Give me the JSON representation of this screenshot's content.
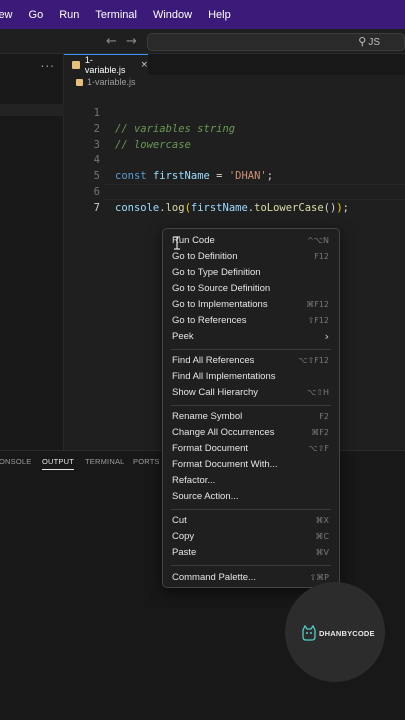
{
  "menubar": {
    "items": [
      "iew",
      "Go",
      "Run",
      "Terminal",
      "Window",
      "Help"
    ]
  },
  "titlebar": {
    "back_icon": "arrow-left-icon",
    "forward_icon": "arrow-right-icon",
    "search_label": "JS"
  },
  "sidebar": {
    "more_label": "..."
  },
  "tab": {
    "label": "1-variable.js",
    "close": "×"
  },
  "breadcrumb": {
    "file": "1-variable.js"
  },
  "editor": {
    "lines": [
      {
        "n": "1",
        "text": "// variables string"
      },
      {
        "n": "2",
        "text": "// lowercase"
      },
      {
        "n": "3",
        "text": ""
      },
      {
        "n": "4",
        "text": "const firstName = 'DHAN';"
      },
      {
        "n": "5",
        "text": ""
      },
      {
        "n": "6",
        "text": "console.log(firstName.toLowerCase());"
      },
      {
        "n": "7",
        "text": ""
      }
    ],
    "tokens": {
      "kw_const": "const",
      "var_firstName": "firstName",
      "op_eq": "=",
      "str_dhan": "'DHAN'",
      "semi": ";",
      "var_console": "console",
      "dot": ".",
      "fn_log": "log",
      "paren_open": "(",
      "fn_lower": "toLowerCase",
      "call_parens": "()",
      "paren_close": ")"
    }
  },
  "panel": {
    "tabs": [
      "ONSOLE",
      "OUTPUT",
      "TERMINAL",
      "PORTS"
    ],
    "active": "OUTPUT"
  },
  "context_menu": {
    "groups": [
      [
        {
          "label": "Run Code",
          "key": "^⌥N"
        },
        {
          "label": "Go to Definition",
          "key": "F12"
        },
        {
          "label": "Go to Type Definition",
          "key": ""
        },
        {
          "label": "Go to Source Definition",
          "key": ""
        },
        {
          "label": "Go to Implementations",
          "key": "⌘F12"
        },
        {
          "label": "Go to References",
          "key": "⇧F12"
        },
        {
          "label": "Peek",
          "key": "›"
        }
      ],
      [
        {
          "label": "Find All References",
          "key": "⌥⇧F12"
        },
        {
          "label": "Find All Implementations",
          "key": ""
        },
        {
          "label": "Show Call Hierarchy",
          "key": "⌥⇧H"
        }
      ],
      [
        {
          "label": "Rename Symbol",
          "key": "F2"
        },
        {
          "label": "Change All Occurrences",
          "key": "⌘F2"
        },
        {
          "label": "Format Document",
          "key": "⌥⇧F"
        },
        {
          "label": "Format Document With...",
          "key": ""
        },
        {
          "label": "Refactor...",
          "key": ""
        },
        {
          "label": "Source Action...",
          "key": ""
        }
      ],
      [
        {
          "label": "Cut",
          "key": "⌘X"
        },
        {
          "label": "Copy",
          "key": "⌘C"
        },
        {
          "label": "Paste",
          "key": "⌘V"
        }
      ],
      [
        {
          "label": "Command Palette...",
          "key": "⇧⌘P"
        }
      ]
    ]
  },
  "watermark": {
    "text": "DHANBYCODE"
  },
  "colors": {
    "menubar": "#3c1a7a",
    "editor_bg": "#1f1f1f",
    "accent": "#3794ff"
  }
}
